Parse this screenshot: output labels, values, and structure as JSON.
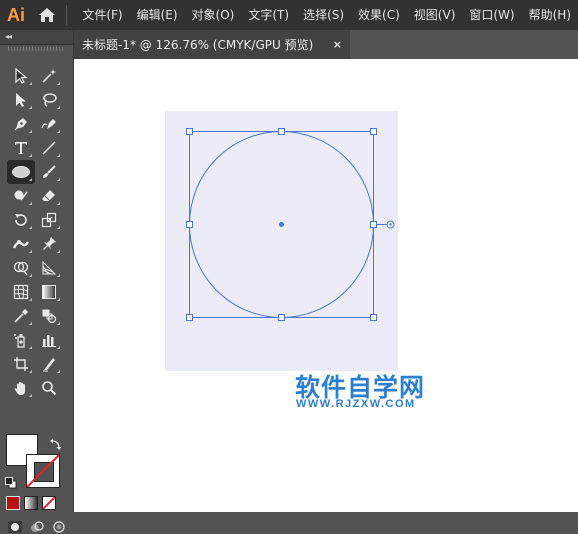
{
  "app": {
    "logo": "Ai",
    "home_icon": "home-icon"
  },
  "menu": {
    "items": [
      {
        "label": "文件(F)"
      },
      {
        "label": "编辑(E)"
      },
      {
        "label": "对象(O)"
      },
      {
        "label": "文字(T)"
      },
      {
        "label": "选择(S)"
      },
      {
        "label": "效果(C)"
      },
      {
        "label": "视图(V)"
      },
      {
        "label": "窗口(W)"
      },
      {
        "label": "帮助(H)"
      }
    ]
  },
  "tools_panel": {
    "collapse_label": "◂◂",
    "tools": [
      [
        "selection-tool-icon",
        "magic-wand-tool-icon"
      ],
      [
        "direct-selection-tool-icon",
        "lasso-tool-icon"
      ],
      [
        "pen-tool-icon",
        "curvature-tool-icon"
      ],
      [
        "type-tool-icon",
        "line-segment-tool-icon"
      ],
      [
        "ellipse-tool-icon",
        "paintbrush-tool-icon"
      ],
      [
        "shaper-tool-icon",
        "eraser-tool-icon"
      ],
      [
        "rotate-tool-icon",
        "scale-tool-icon"
      ],
      [
        "width-tool-icon",
        "puppet-warp-tool-icon"
      ],
      [
        "shape-builder-tool-icon",
        "perspective-grid-tool-icon"
      ],
      [
        "mesh-tool-icon",
        "gradient-tool-icon"
      ],
      [
        "eyedropper-tool-icon",
        "blend-tool-icon"
      ],
      [
        "symbol-sprayer-tool-icon",
        "column-graph-tool-icon"
      ],
      [
        "artboard-tool-icon",
        "slice-tool-icon"
      ],
      [
        "hand-tool-icon",
        "zoom-tool-icon"
      ]
    ],
    "selected_tool": "ellipse-tool-icon",
    "fill_color": "#ffffff",
    "stroke": "none"
  },
  "document": {
    "tab_title": "未标题-1* @ 126.76% (CMYK/GPU 预览)",
    "close_label": "×"
  },
  "artwork": {
    "shape": "circle",
    "stroke_color": "#4a74d8",
    "artboard_color": "#ececf8"
  },
  "watermark": {
    "title": "软件自学网",
    "url": "WWW.RJZXW.COM"
  },
  "colors": {
    "menubar": "#323232",
    "panel": "#535353",
    "accent_logo": "#ff9a3c",
    "selection": "#4a74d8"
  }
}
